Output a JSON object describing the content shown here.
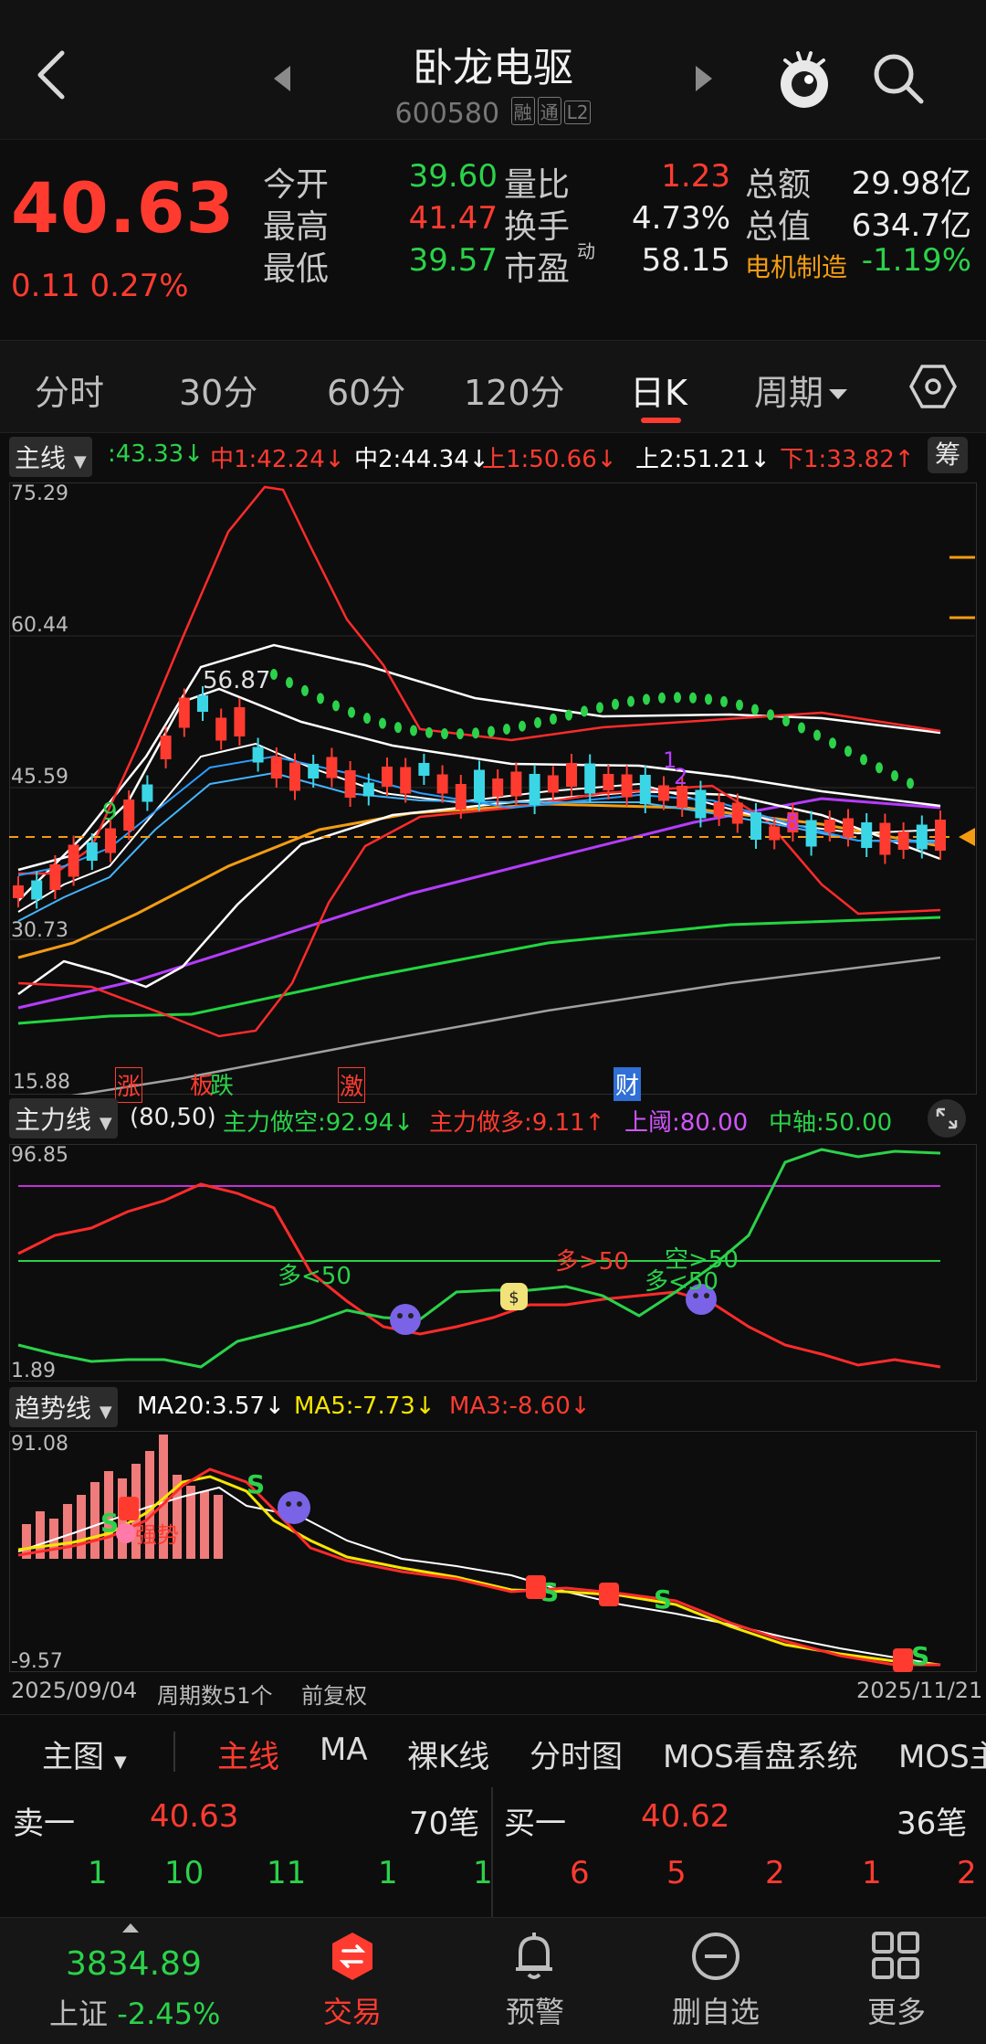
{
  "header": {
    "title": "卧龙电驱",
    "code": "600580",
    "tags": [
      "融",
      "通",
      "L2"
    ]
  },
  "quote": {
    "price": "40.63",
    "change": "0.11",
    "change_pct": "0.27%",
    "rows": [
      {
        "l1": "今开",
        "v1": "39.60",
        "c1": "green",
        "l2": "量比",
        "v2": "1.23",
        "c2": "red",
        "l3": "总额",
        "v3": "29.98亿",
        "c3": "white"
      },
      {
        "l1": "最高",
        "v1": "41.47",
        "c1": "red",
        "l2": "换手",
        "v2": "4.73%",
        "c2": "white",
        "l3": "总值",
        "v3": "634.7亿",
        "c3": "white"
      },
      {
        "l1": "最低",
        "v1": "39.57",
        "c1": "green",
        "l2": "市盈",
        "sup2": "动",
        "v2": "58.15",
        "c2": "white",
        "l3": "电机制造",
        "v3": "-1.19%",
        "c3": "green"
      }
    ]
  },
  "periods": {
    "tabs": [
      "分时",
      "30分",
      "60分",
      "120分",
      "日K",
      "周期"
    ],
    "active": "日K"
  },
  "main_chart": {
    "selector": "主线",
    "legend": [
      {
        "text": ":43.33↓",
        "color": "#2bd24a"
      },
      {
        "text": "中1:42.24↓",
        "color": "#ff3b30"
      },
      {
        "text": "中2:44.34↓",
        "color": "#ffffff"
      },
      {
        "text": "上1:50.66↓",
        "color": "#ff3b30"
      },
      {
        "text": "上2:51.21↓",
        "color": "#ffffff"
      },
      {
        "text": "下1:33.82↑",
        "color": "#ff3b30"
      }
    ],
    "chip_button": "筹",
    "y_labels": [
      "75.29",
      "60.44",
      "45.59",
      "30.73",
      "15.88"
    ],
    "peak_label": "56.87",
    "event_tags": [
      {
        "text": "涨",
        "color": "#ff3b30"
      },
      {
        "text": "板",
        "color": "#ff3b30"
      },
      {
        "text": "跌",
        "color": "#2bd24a"
      },
      {
        "text": "激",
        "color": "#ff3b30"
      },
      {
        "text": "财",
        "color": "#3a8ef6"
      }
    ]
  },
  "force_chart": {
    "selector": "主力线",
    "params": "(80,50)",
    "legend": [
      {
        "text": "主力做空:92.94↓",
        "color": "#2bd24a"
      },
      {
        "text": "主力做多:9.11↑",
        "color": "#ff3b30"
      },
      {
        "text": "上阈:80.00",
        "color": "#d155ff"
      },
      {
        "text": "中轴:50.00",
        "color": "#2bd24a"
      }
    ],
    "y_labels": [
      "96.85",
      "1.89"
    ],
    "annotations": [
      {
        "text": "多<50",
        "color": "#2bd24a"
      },
      {
        "text": "多>50",
        "color": "#ff3b30"
      },
      {
        "text": "空>50",
        "color": "#2bd24a"
      },
      {
        "text": "多<50",
        "color": "#2bd24a"
      }
    ]
  },
  "trend_chart": {
    "selector": "趋势线",
    "legend": [
      {
        "text": "MA20:3.57↓",
        "color": "#ffffff"
      },
      {
        "text": "MA5:-7.73↓",
        "color": "#f5e600"
      },
      {
        "text": "MA3:-8.60↓",
        "color": "#ff3b30"
      }
    ],
    "y_labels": [
      "91.08",
      "-9.57"
    ],
    "strong_label": "强势"
  },
  "date_bar": {
    "start": "2025/09/04",
    "count": "周期数51个",
    "adjust": "前复权",
    "end": "2025/11/21"
  },
  "indicator_tabs": [
    "主图",
    "主线",
    "MA",
    "裸K线",
    "分时图",
    "MOS看盘系统",
    "MOS主"
  ],
  "orderbook": {
    "sell_label": "卖一",
    "sell_price": "40.63",
    "sell_count": "70笔",
    "buy_label": "买一",
    "buy_price": "40.62",
    "buy_count": "36笔",
    "sell_detail": [
      "1",
      "10",
      "11",
      "1",
      "1"
    ],
    "buy_detail": [
      "6",
      "5",
      "2",
      "1",
      "2"
    ]
  },
  "bottom_nav": {
    "index_value": "3834.89",
    "index_name": "上证",
    "index_change": "-2.45%",
    "items": [
      "交易",
      "预警",
      "删自选",
      "更多"
    ]
  }
}
